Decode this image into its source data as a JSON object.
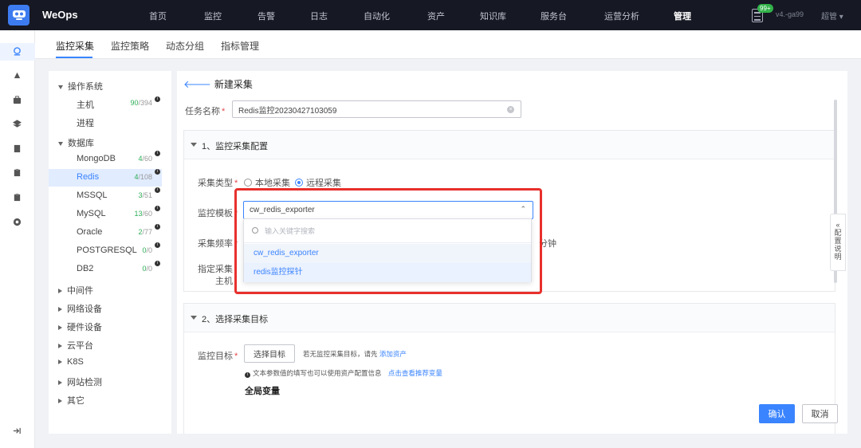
{
  "app": {
    "name": "WeOps"
  },
  "nav": {
    "items": [
      "首页",
      "监控",
      "告警",
      "日志",
      "自动化",
      "资产",
      "知识库",
      "服务台",
      "运营分析",
      "管理"
    ],
    "active": "管理",
    "notice_badge": "99+",
    "version": "v4.-ga99",
    "user": "超管 ▾"
  },
  "tabs": {
    "items": [
      "监控采集",
      "监控策略",
      "动态分组",
      "指标管理"
    ],
    "active": "监控采集"
  },
  "tree": {
    "os_group": "操作系统",
    "os_items": [
      {
        "label": "主机",
        "used": "90",
        "total": "/394"
      },
      {
        "label": "进程"
      }
    ],
    "db_group": "数据库",
    "db_items": [
      {
        "label": "MongoDB",
        "used": "4",
        "total": "/60"
      },
      {
        "label": "Redis",
        "used": "4",
        "total": "/108"
      },
      {
        "label": "MSSQL",
        "used": "3",
        "total": "/51"
      },
      {
        "label": "MySQL",
        "used": "13",
        "total": "/60"
      },
      {
        "label": "Oracle",
        "used": "2",
        "total": "/77"
      },
      {
        "label": "POSTGRESQL",
        "used": "0",
        "total": "/0"
      },
      {
        "label": "DB2",
        "used": "0",
        "total": "/0"
      }
    ],
    "other_groups": [
      "中间件",
      "网络设备",
      "硬件设备",
      "云平台",
      "K8S",
      "网站检测",
      "其它"
    ]
  },
  "form": {
    "back_label": "新建采集",
    "task_name_label": "任务名称",
    "task_name_value": "Redis监控20230427103059",
    "section1_title": "1、监控采集配置",
    "collect_type_label": "采集类型",
    "collect_type_local": "本地采集",
    "collect_type_remote": "远程采集",
    "template_label": "监控模板",
    "template_value": "cw_redis_exporter",
    "freq_label": "采集频率",
    "freq_unit": "分钟",
    "host_label_1": "指定采集",
    "host_label_2": "主机",
    "section2_title": "2、选择采集目标",
    "target_label": "监控目标",
    "select_target_button": "选择目标",
    "target_hint_prefix": "若无监控采集目标，请先",
    "target_hint_link": "添加资产",
    "param_note": "文本参数值的填写也可以使用资产配置信息",
    "param_link": "点击查看推荐变量",
    "global_vars_title": "全局变量",
    "side_tab": "«\n配\n置\n说\n明",
    "confirm_button": "确认",
    "cancel_button": "取消"
  },
  "dropdown": {
    "search_placeholder": "输入关键字搜索",
    "options": [
      "cw_redis_exporter",
      "redis监控探针"
    ],
    "selected": "cw_redis_exporter"
  },
  "colors": {
    "accent": "#3a84ff",
    "highlight_frame": "#e8302c",
    "topbar": "#161823"
  }
}
